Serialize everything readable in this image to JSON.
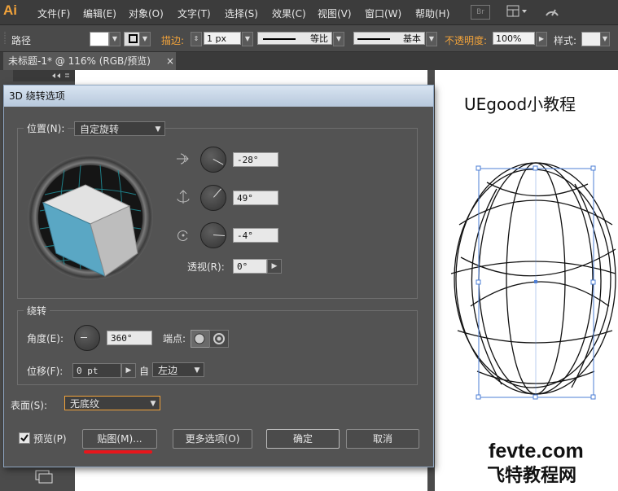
{
  "app": {
    "logo": "Ai"
  },
  "menu": [
    "文件(F)",
    "编辑(E)",
    "对象(O)",
    "文字(T)",
    "选择(S)",
    "效果(C)",
    "视图(V)",
    "窗口(W)",
    "帮助(H)"
  ],
  "menu_br": "Br",
  "control_bar": {
    "path_label": "路径",
    "stroke_label": "描边:",
    "stroke_value": "1 px",
    "profile_label": "等比",
    "brush_label": "基本",
    "opacity_label": "不透明度:",
    "opacity_value": "100%",
    "style_label": "样式:"
  },
  "tab": {
    "title": "未标题-1* @ 116% (RGB/预览)",
    "close": "×"
  },
  "dialog": {
    "title": "3D 绕转选项",
    "position_label": "位置(N):",
    "position_value": "自定旋转",
    "x_angle": "-28°",
    "y_angle": "49°",
    "z_angle": "-4°",
    "perspective_label": "透视(R):",
    "perspective_value": "0°",
    "revolve_group": "绕转",
    "angle_label": "角度(E):",
    "angle_value": "360°",
    "cap_label": "端点:",
    "offset_label": "位移(F):",
    "offset_value": "0 pt",
    "from_label": "自",
    "from_value": "左边",
    "surface_label": "表面(S):",
    "surface_value": "无底纹",
    "preview_label": "预览(P)",
    "preview_checked": true,
    "map_button": "贴图(M)...",
    "more_button": "更多选项(O)",
    "ok_button": "确定",
    "cancel_button": "取消"
  },
  "canvas": {
    "title_text": "UEgood小教程",
    "watermark_1": "fevte.com",
    "watermark_2": "飞特教程网"
  },
  "colors": {
    "cube_face": "#5aa7c4",
    "grid": "#1f8a94",
    "accent_label": "#f2a33a",
    "underline": "#e8151b"
  }
}
